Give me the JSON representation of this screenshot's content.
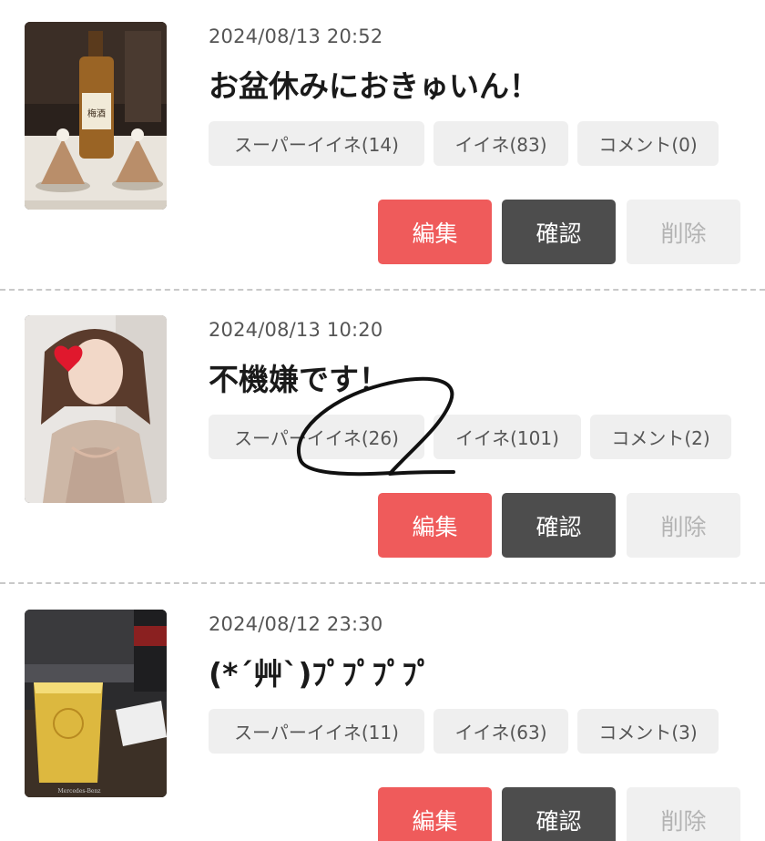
{
  "posts": [
    {
      "date": "2024/08/13 20:52",
      "title": "お盆休みにおきゅいん！",
      "super_like": "スーパーイイネ(14)",
      "like": "イイネ(83)",
      "comment": "コメント(0)",
      "edit": "編集",
      "confirm": "確認",
      "delete": "削除",
      "image_label": "梅酒"
    },
    {
      "date": "2024/08/13 10:20",
      "title": "不機嫌です！",
      "super_like": "スーパーイイネ(26)",
      "like": "イイネ(101)",
      "comment": "コメント(2)",
      "edit": "編集",
      "confirm": "確認",
      "delete": "削除"
    },
    {
      "date": "2024/08/12 23:30",
      "title": "(*´艸`)ﾌﾟﾌﾟﾌﾟﾌﾟ",
      "super_like": "スーパーイイネ(11)",
      "like": "イイネ(63)",
      "comment": "コメント(3)",
      "edit": "編集",
      "confirm": "確認",
      "delete": "削除",
      "image_label": "Mercedes-Benz"
    }
  ],
  "colors": {
    "edit": "#ef5b5b",
    "confirm": "#4d4d4d",
    "delete_bg": "#f0f0f0",
    "stat_bg": "#efefef"
  }
}
